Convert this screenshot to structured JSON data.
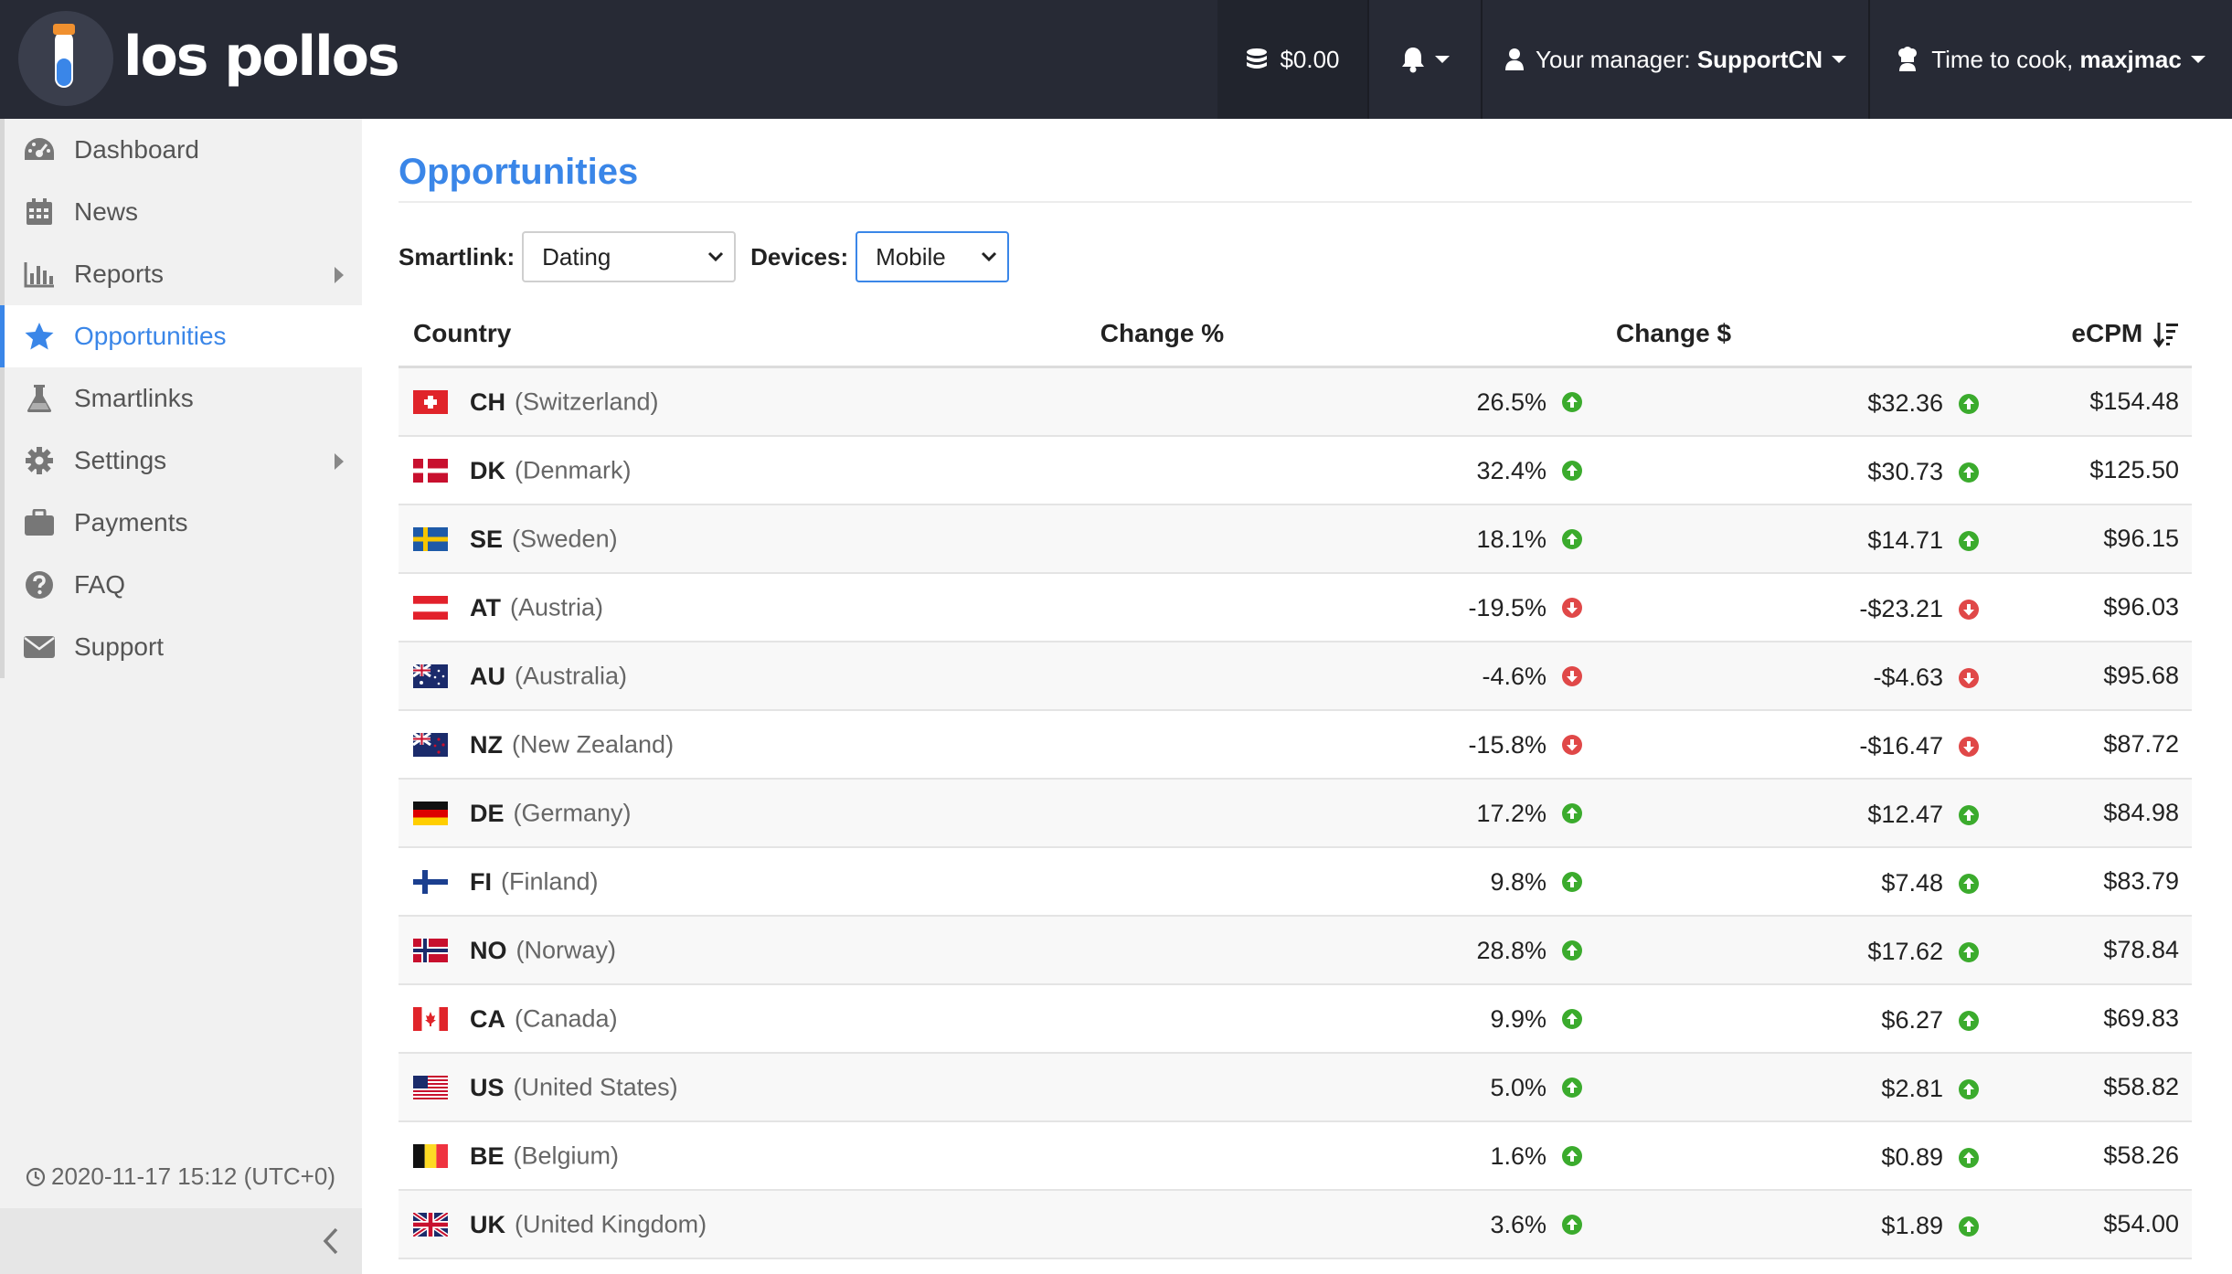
{
  "brand": {
    "name": "los pollos"
  },
  "topbar": {
    "balance": "$0.00",
    "manager_prefix": "Your manager: ",
    "manager_name": "SupportCN",
    "greeting_prefix": "Time to cook, ",
    "user_name": "maxjmac"
  },
  "sidebar": {
    "items": [
      {
        "label": "Dashboard",
        "icon": "dashboard-icon"
      },
      {
        "label": "News",
        "icon": "calendar-icon"
      },
      {
        "label": "Reports",
        "icon": "bar-chart-icon"
      },
      {
        "label": "Opportunities",
        "icon": "star-icon"
      },
      {
        "label": "Smartlinks",
        "icon": "flask-icon"
      },
      {
        "label": "Settings",
        "icon": "gear-icon"
      },
      {
        "label": "Payments",
        "icon": "briefcase-icon"
      },
      {
        "label": "FAQ",
        "icon": "question-icon"
      },
      {
        "label": "Support",
        "icon": "envelope-icon"
      }
    ],
    "timestamp": "2020-11-17 15:12 (UTC+0)"
  },
  "main": {
    "title": "Opportunities",
    "filters": {
      "smartlink_label": "Smartlink:",
      "smartlink_value": "Dating",
      "devices_label": "Devices:",
      "devices_value": "Mobile"
    },
    "table": {
      "headers": {
        "country": "Country",
        "change_pct": "Change %",
        "change_usd": "Change $",
        "ecpm": "eCPM"
      },
      "rows": [
        {
          "code": "CH",
          "name": "(Switzerland)",
          "change_pct": "26.5%",
          "change_usd": "$32.36",
          "ecpm": "$154.48",
          "trend": "up"
        },
        {
          "code": "DK",
          "name": "(Denmark)",
          "change_pct": "32.4%",
          "change_usd": "$30.73",
          "ecpm": "$125.50",
          "trend": "up"
        },
        {
          "code": "SE",
          "name": "(Sweden)",
          "change_pct": "18.1%",
          "change_usd": "$14.71",
          "ecpm": "$96.15",
          "trend": "up"
        },
        {
          "code": "AT",
          "name": "(Austria)",
          "change_pct": "-19.5%",
          "change_usd": "-$23.21",
          "ecpm": "$96.03",
          "trend": "down"
        },
        {
          "code": "AU",
          "name": "(Australia)",
          "change_pct": "-4.6%",
          "change_usd": "-$4.63",
          "ecpm": "$95.68",
          "trend": "down"
        },
        {
          "code": "NZ",
          "name": "(New Zealand)",
          "change_pct": "-15.8%",
          "change_usd": "-$16.47",
          "ecpm": "$87.72",
          "trend": "down"
        },
        {
          "code": "DE",
          "name": "(Germany)",
          "change_pct": "17.2%",
          "change_usd": "$12.47",
          "ecpm": "$84.98",
          "trend": "up"
        },
        {
          "code": "FI",
          "name": "(Finland)",
          "change_pct": "9.8%",
          "change_usd": "$7.48",
          "ecpm": "$83.79",
          "trend": "up"
        },
        {
          "code": "NO",
          "name": "(Norway)",
          "change_pct": "28.8%",
          "change_usd": "$17.62",
          "ecpm": "$78.84",
          "trend": "up"
        },
        {
          "code": "CA",
          "name": "(Canada)",
          "change_pct": "9.9%",
          "change_usd": "$6.27",
          "ecpm": "$69.83",
          "trend": "up"
        },
        {
          "code": "US",
          "name": "(United States)",
          "change_pct": "5.0%",
          "change_usd": "$2.81",
          "ecpm": "$58.82",
          "trend": "up"
        },
        {
          "code": "BE",
          "name": "(Belgium)",
          "change_pct": "1.6%",
          "change_usd": "$0.89",
          "ecpm": "$58.26",
          "trend": "up"
        },
        {
          "code": "UK",
          "name": "(United Kingdom)",
          "change_pct": "3.6%",
          "change_usd": "$1.89",
          "ecpm": "$54.00",
          "trend": "up"
        }
      ]
    }
  },
  "colors": {
    "accent": "#3a86e8",
    "topbar": "#272a35",
    "up": "#3bab2d",
    "down": "#e04848"
  }
}
